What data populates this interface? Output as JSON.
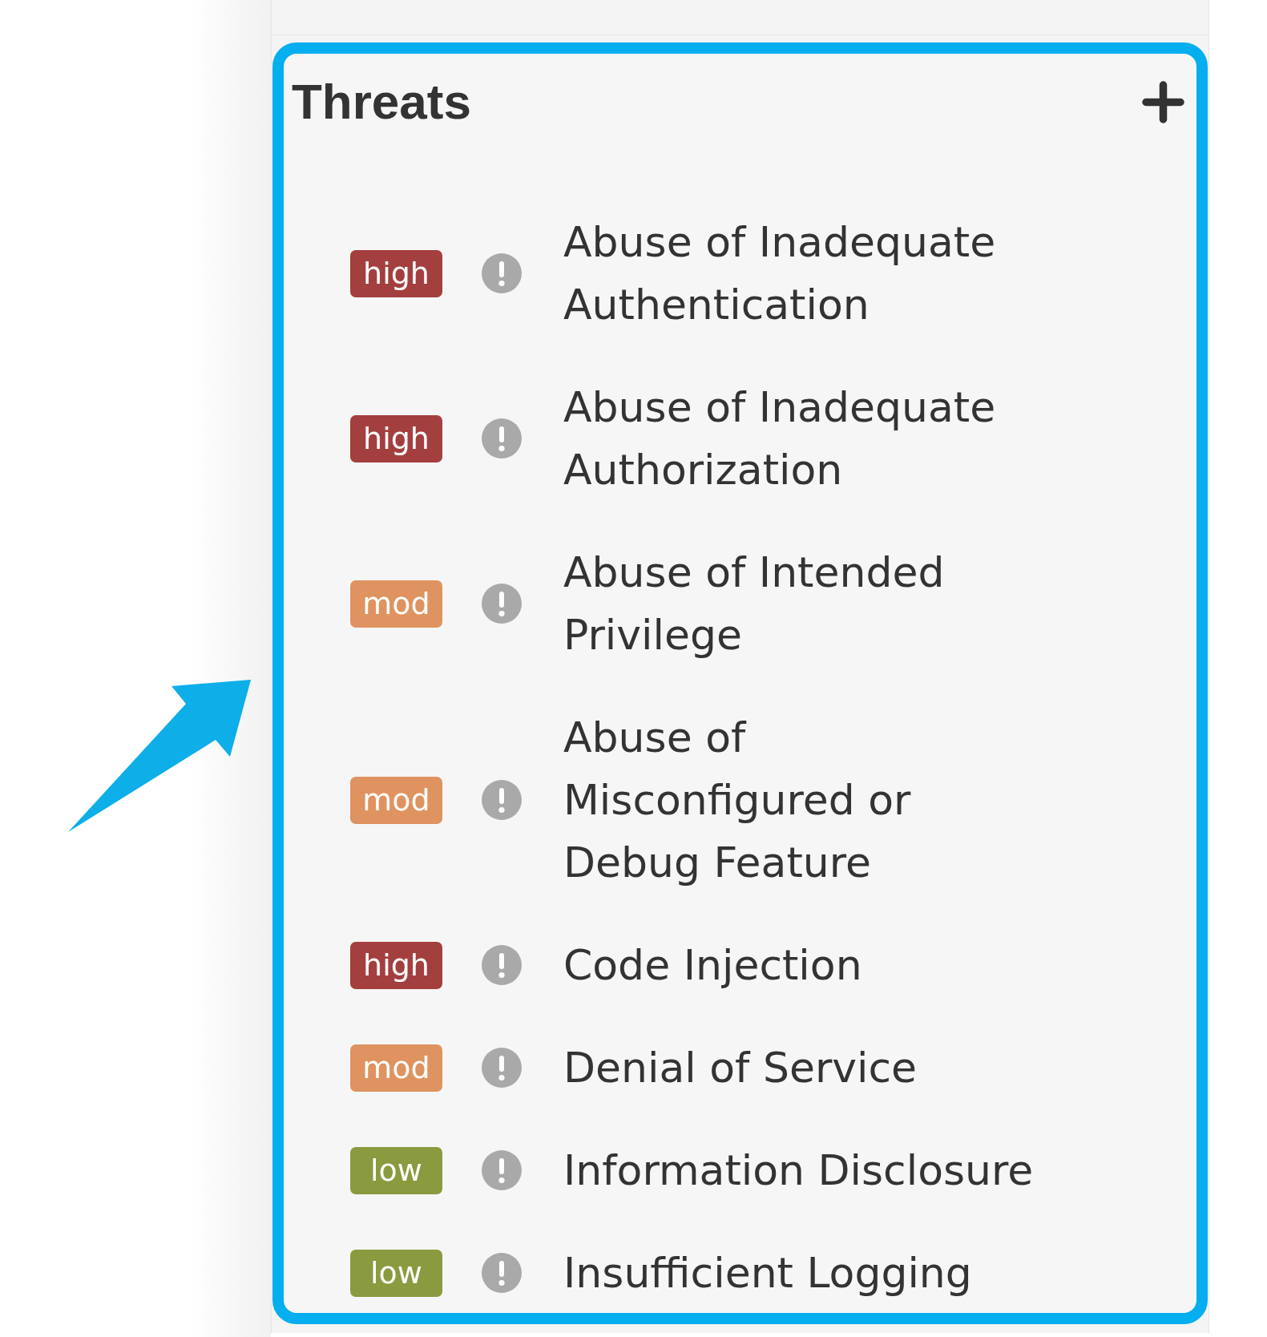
{
  "panel": {
    "title": "Threats"
  },
  "threats": [
    {
      "severity": "high",
      "color": "#a43f3f",
      "name": "Abuse of Inadequate Authentication"
    },
    {
      "severity": "high",
      "color": "#a43f3f",
      "name": "Abuse of Inadequate Authorization"
    },
    {
      "severity": "mod",
      "color": "#df9360",
      "name": "Abuse of Intended Privilege"
    },
    {
      "severity": "mod",
      "color": "#df9360",
      "name": "Abuse of Misconfigured or Debug Feature"
    },
    {
      "severity": "high",
      "color": "#a43f3f",
      "name": "Code Injection"
    },
    {
      "severity": "mod",
      "color": "#df9360",
      "name": "Denial of Service"
    },
    {
      "severity": "low",
      "color": "#8a9a3f",
      "name": "Information Disclosure"
    },
    {
      "severity": "low",
      "color": "#8a9a3f",
      "name": "Insufficient Logging"
    }
  ]
}
